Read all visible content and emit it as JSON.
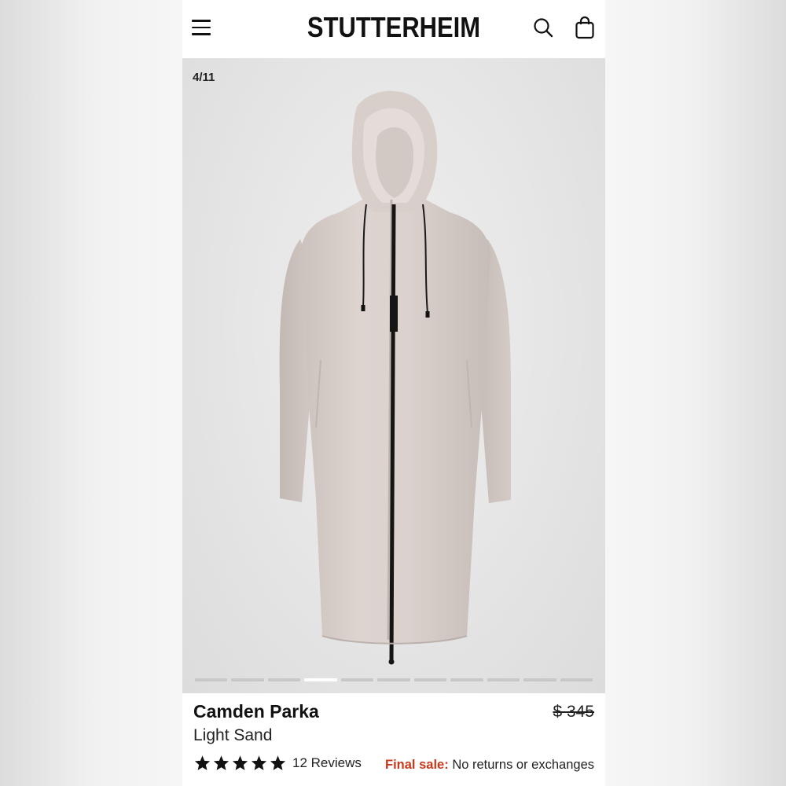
{
  "header": {
    "brand": "STUTTERHEIM"
  },
  "gallery": {
    "counter": "4/11",
    "current_index": 4,
    "total": 11
  },
  "product": {
    "name": "Camden Parka",
    "color": "Light Sand",
    "price": "$ 345",
    "rating": 5,
    "reviews": "12 Reviews",
    "final_sale_label": "Final sale:",
    "final_sale_text": "No returns or exchanges"
  },
  "colors": {
    "accent_red": "#c8391b",
    "coat": "#d9d0cc"
  }
}
